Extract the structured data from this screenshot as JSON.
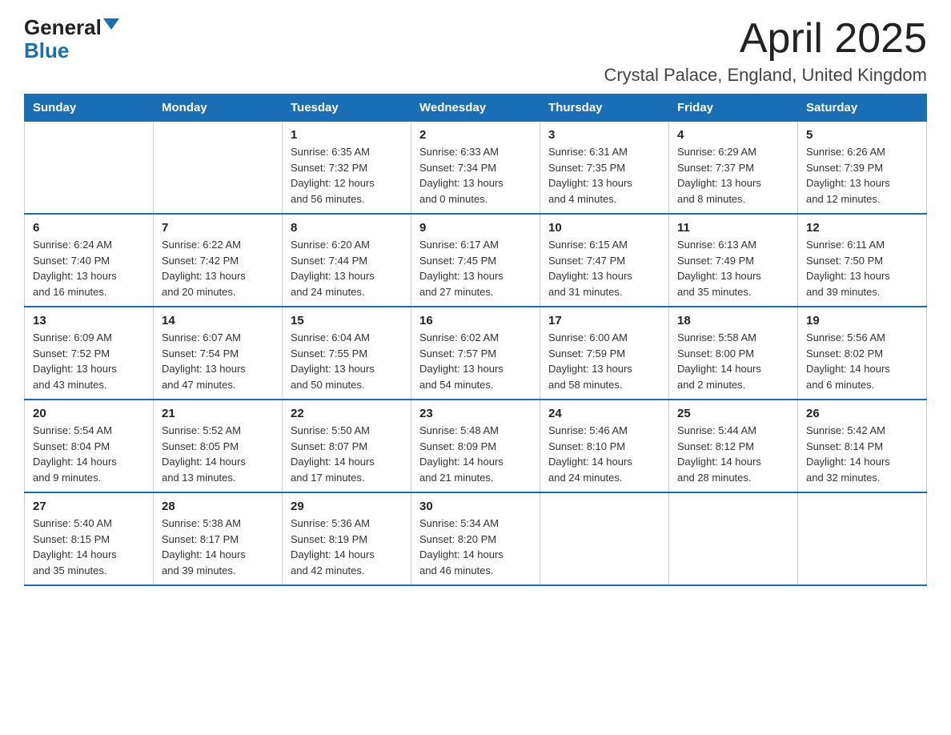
{
  "logo": {
    "general": "General",
    "blue": "Blue"
  },
  "title": "April 2025",
  "subtitle": "Crystal Palace, England, United Kingdom",
  "days_of_week": [
    "Sunday",
    "Monday",
    "Tuesday",
    "Wednesday",
    "Thursday",
    "Friday",
    "Saturday"
  ],
  "weeks": [
    [
      {
        "day": "",
        "info": ""
      },
      {
        "day": "",
        "info": ""
      },
      {
        "day": "1",
        "info": "Sunrise: 6:35 AM\nSunset: 7:32 PM\nDaylight: 12 hours\nand 56 minutes."
      },
      {
        "day": "2",
        "info": "Sunrise: 6:33 AM\nSunset: 7:34 PM\nDaylight: 13 hours\nand 0 minutes."
      },
      {
        "day": "3",
        "info": "Sunrise: 6:31 AM\nSunset: 7:35 PM\nDaylight: 13 hours\nand 4 minutes."
      },
      {
        "day": "4",
        "info": "Sunrise: 6:29 AM\nSunset: 7:37 PM\nDaylight: 13 hours\nand 8 minutes."
      },
      {
        "day": "5",
        "info": "Sunrise: 6:26 AM\nSunset: 7:39 PM\nDaylight: 13 hours\nand 12 minutes."
      }
    ],
    [
      {
        "day": "6",
        "info": "Sunrise: 6:24 AM\nSunset: 7:40 PM\nDaylight: 13 hours\nand 16 minutes."
      },
      {
        "day": "7",
        "info": "Sunrise: 6:22 AM\nSunset: 7:42 PM\nDaylight: 13 hours\nand 20 minutes."
      },
      {
        "day": "8",
        "info": "Sunrise: 6:20 AM\nSunset: 7:44 PM\nDaylight: 13 hours\nand 24 minutes."
      },
      {
        "day": "9",
        "info": "Sunrise: 6:17 AM\nSunset: 7:45 PM\nDaylight: 13 hours\nand 27 minutes."
      },
      {
        "day": "10",
        "info": "Sunrise: 6:15 AM\nSunset: 7:47 PM\nDaylight: 13 hours\nand 31 minutes."
      },
      {
        "day": "11",
        "info": "Sunrise: 6:13 AM\nSunset: 7:49 PM\nDaylight: 13 hours\nand 35 minutes."
      },
      {
        "day": "12",
        "info": "Sunrise: 6:11 AM\nSunset: 7:50 PM\nDaylight: 13 hours\nand 39 minutes."
      }
    ],
    [
      {
        "day": "13",
        "info": "Sunrise: 6:09 AM\nSunset: 7:52 PM\nDaylight: 13 hours\nand 43 minutes."
      },
      {
        "day": "14",
        "info": "Sunrise: 6:07 AM\nSunset: 7:54 PM\nDaylight: 13 hours\nand 47 minutes."
      },
      {
        "day": "15",
        "info": "Sunrise: 6:04 AM\nSunset: 7:55 PM\nDaylight: 13 hours\nand 50 minutes."
      },
      {
        "day": "16",
        "info": "Sunrise: 6:02 AM\nSunset: 7:57 PM\nDaylight: 13 hours\nand 54 minutes."
      },
      {
        "day": "17",
        "info": "Sunrise: 6:00 AM\nSunset: 7:59 PM\nDaylight: 13 hours\nand 58 minutes."
      },
      {
        "day": "18",
        "info": "Sunrise: 5:58 AM\nSunset: 8:00 PM\nDaylight: 14 hours\nand 2 minutes."
      },
      {
        "day": "19",
        "info": "Sunrise: 5:56 AM\nSunset: 8:02 PM\nDaylight: 14 hours\nand 6 minutes."
      }
    ],
    [
      {
        "day": "20",
        "info": "Sunrise: 5:54 AM\nSunset: 8:04 PM\nDaylight: 14 hours\nand 9 minutes."
      },
      {
        "day": "21",
        "info": "Sunrise: 5:52 AM\nSunset: 8:05 PM\nDaylight: 14 hours\nand 13 minutes."
      },
      {
        "day": "22",
        "info": "Sunrise: 5:50 AM\nSunset: 8:07 PM\nDaylight: 14 hours\nand 17 minutes."
      },
      {
        "day": "23",
        "info": "Sunrise: 5:48 AM\nSunset: 8:09 PM\nDaylight: 14 hours\nand 21 minutes."
      },
      {
        "day": "24",
        "info": "Sunrise: 5:46 AM\nSunset: 8:10 PM\nDaylight: 14 hours\nand 24 minutes."
      },
      {
        "day": "25",
        "info": "Sunrise: 5:44 AM\nSunset: 8:12 PM\nDaylight: 14 hours\nand 28 minutes."
      },
      {
        "day": "26",
        "info": "Sunrise: 5:42 AM\nSunset: 8:14 PM\nDaylight: 14 hours\nand 32 minutes."
      }
    ],
    [
      {
        "day": "27",
        "info": "Sunrise: 5:40 AM\nSunset: 8:15 PM\nDaylight: 14 hours\nand 35 minutes."
      },
      {
        "day": "28",
        "info": "Sunrise: 5:38 AM\nSunset: 8:17 PM\nDaylight: 14 hours\nand 39 minutes."
      },
      {
        "day": "29",
        "info": "Sunrise: 5:36 AM\nSunset: 8:19 PM\nDaylight: 14 hours\nand 42 minutes."
      },
      {
        "day": "30",
        "info": "Sunrise: 5:34 AM\nSunset: 8:20 PM\nDaylight: 14 hours\nand 46 minutes."
      },
      {
        "day": "",
        "info": ""
      },
      {
        "day": "",
        "info": ""
      },
      {
        "day": "",
        "info": ""
      }
    ]
  ]
}
